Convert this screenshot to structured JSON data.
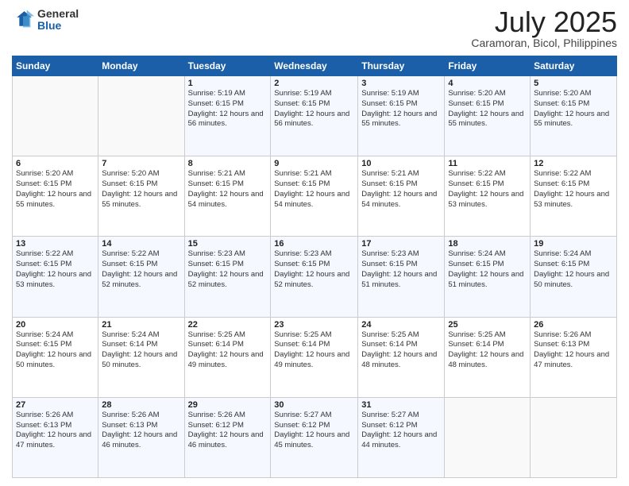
{
  "logo": {
    "general": "General",
    "blue": "Blue"
  },
  "header": {
    "month": "July 2025",
    "location": "Caramoran, Bicol, Philippines"
  },
  "weekdays": [
    "Sunday",
    "Monday",
    "Tuesday",
    "Wednesday",
    "Thursday",
    "Friday",
    "Saturday"
  ],
  "weeks": [
    [
      {
        "day": "",
        "info": ""
      },
      {
        "day": "",
        "info": ""
      },
      {
        "day": "1",
        "info": "Sunrise: 5:19 AM\nSunset: 6:15 PM\nDaylight: 12 hours and 56 minutes."
      },
      {
        "day": "2",
        "info": "Sunrise: 5:19 AM\nSunset: 6:15 PM\nDaylight: 12 hours and 56 minutes."
      },
      {
        "day": "3",
        "info": "Sunrise: 5:19 AM\nSunset: 6:15 PM\nDaylight: 12 hours and 55 minutes."
      },
      {
        "day": "4",
        "info": "Sunrise: 5:20 AM\nSunset: 6:15 PM\nDaylight: 12 hours and 55 minutes."
      },
      {
        "day": "5",
        "info": "Sunrise: 5:20 AM\nSunset: 6:15 PM\nDaylight: 12 hours and 55 minutes."
      }
    ],
    [
      {
        "day": "6",
        "info": "Sunrise: 5:20 AM\nSunset: 6:15 PM\nDaylight: 12 hours and 55 minutes."
      },
      {
        "day": "7",
        "info": "Sunrise: 5:20 AM\nSunset: 6:15 PM\nDaylight: 12 hours and 55 minutes."
      },
      {
        "day": "8",
        "info": "Sunrise: 5:21 AM\nSunset: 6:15 PM\nDaylight: 12 hours and 54 minutes."
      },
      {
        "day": "9",
        "info": "Sunrise: 5:21 AM\nSunset: 6:15 PM\nDaylight: 12 hours and 54 minutes."
      },
      {
        "day": "10",
        "info": "Sunrise: 5:21 AM\nSunset: 6:15 PM\nDaylight: 12 hours and 54 minutes."
      },
      {
        "day": "11",
        "info": "Sunrise: 5:22 AM\nSunset: 6:15 PM\nDaylight: 12 hours and 53 minutes."
      },
      {
        "day": "12",
        "info": "Sunrise: 5:22 AM\nSunset: 6:15 PM\nDaylight: 12 hours and 53 minutes."
      }
    ],
    [
      {
        "day": "13",
        "info": "Sunrise: 5:22 AM\nSunset: 6:15 PM\nDaylight: 12 hours and 53 minutes."
      },
      {
        "day": "14",
        "info": "Sunrise: 5:22 AM\nSunset: 6:15 PM\nDaylight: 12 hours and 52 minutes."
      },
      {
        "day": "15",
        "info": "Sunrise: 5:23 AM\nSunset: 6:15 PM\nDaylight: 12 hours and 52 minutes."
      },
      {
        "day": "16",
        "info": "Sunrise: 5:23 AM\nSunset: 6:15 PM\nDaylight: 12 hours and 52 minutes."
      },
      {
        "day": "17",
        "info": "Sunrise: 5:23 AM\nSunset: 6:15 PM\nDaylight: 12 hours and 51 minutes."
      },
      {
        "day": "18",
        "info": "Sunrise: 5:24 AM\nSunset: 6:15 PM\nDaylight: 12 hours and 51 minutes."
      },
      {
        "day": "19",
        "info": "Sunrise: 5:24 AM\nSunset: 6:15 PM\nDaylight: 12 hours and 50 minutes."
      }
    ],
    [
      {
        "day": "20",
        "info": "Sunrise: 5:24 AM\nSunset: 6:15 PM\nDaylight: 12 hours and 50 minutes."
      },
      {
        "day": "21",
        "info": "Sunrise: 5:24 AM\nSunset: 6:14 PM\nDaylight: 12 hours and 50 minutes."
      },
      {
        "day": "22",
        "info": "Sunrise: 5:25 AM\nSunset: 6:14 PM\nDaylight: 12 hours and 49 minutes."
      },
      {
        "day": "23",
        "info": "Sunrise: 5:25 AM\nSunset: 6:14 PM\nDaylight: 12 hours and 49 minutes."
      },
      {
        "day": "24",
        "info": "Sunrise: 5:25 AM\nSunset: 6:14 PM\nDaylight: 12 hours and 48 minutes."
      },
      {
        "day": "25",
        "info": "Sunrise: 5:25 AM\nSunset: 6:14 PM\nDaylight: 12 hours and 48 minutes."
      },
      {
        "day": "26",
        "info": "Sunrise: 5:26 AM\nSunset: 6:13 PM\nDaylight: 12 hours and 47 minutes."
      }
    ],
    [
      {
        "day": "27",
        "info": "Sunrise: 5:26 AM\nSunset: 6:13 PM\nDaylight: 12 hours and 47 minutes."
      },
      {
        "day": "28",
        "info": "Sunrise: 5:26 AM\nSunset: 6:13 PM\nDaylight: 12 hours and 46 minutes."
      },
      {
        "day": "29",
        "info": "Sunrise: 5:26 AM\nSunset: 6:12 PM\nDaylight: 12 hours and 46 minutes."
      },
      {
        "day": "30",
        "info": "Sunrise: 5:27 AM\nSunset: 6:12 PM\nDaylight: 12 hours and 45 minutes."
      },
      {
        "day": "31",
        "info": "Sunrise: 5:27 AM\nSunset: 6:12 PM\nDaylight: 12 hours and 44 minutes."
      },
      {
        "day": "",
        "info": ""
      },
      {
        "day": "",
        "info": ""
      }
    ]
  ]
}
